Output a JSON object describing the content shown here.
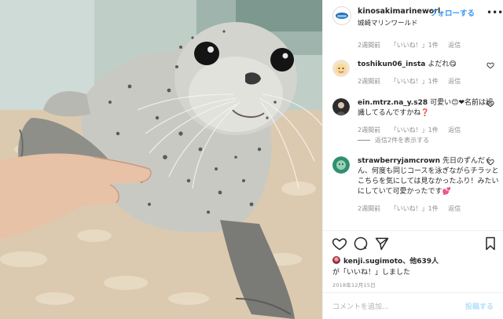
{
  "header": {
    "username": "kinosakimarineworl",
    "follow_label": "フォローする",
    "location": "城崎マリンワールド",
    "more_icon": "more-horizontal-icon"
  },
  "top_meta": {
    "time": "2週間前",
    "likes": "「いいね！」1件",
    "reply": "返信"
  },
  "comments": [
    {
      "username": "toshikun06_insta",
      "text": "よだれ😋",
      "time": "2週間前",
      "likes": "「いいね！」1件",
      "reply": "返信"
    },
    {
      "username": "ein.mtrz.na_y.s28",
      "text": "可愛い😊❤名前は認識してるんですかね❓",
      "time": "2週間前",
      "likes": "「いいね！」1件",
      "reply": "返信",
      "view_replies": "返信2件を表示する"
    },
    {
      "username": "strawberryjamcrown",
      "text": "先日のずんだくん、何度も同じコースを泳ぎながらチラッとこちらを気にしては見なかったふり！みたいにしていて可愛かったです💕",
      "time": "2週間前",
      "likes": "「いいね！」1件",
      "reply": "返信"
    }
  ],
  "actions": {
    "like_icon": "heart-icon",
    "comment_icon": "comment-icon",
    "share_icon": "share-icon",
    "save_icon": "bookmark-icon"
  },
  "likes_summary": {
    "user": "kenji.sugimoto",
    "others": "、他639人",
    "line2": "が「いいね！」しました"
  },
  "date": "2018年12月15日",
  "comment_box": {
    "placeholder": "コメントを追加...",
    "post_label": "投稿する"
  },
  "colors": {
    "link_blue": "#3897f0",
    "post_disabled": "#b2dffc",
    "muted": "#8e8e8e"
  }
}
